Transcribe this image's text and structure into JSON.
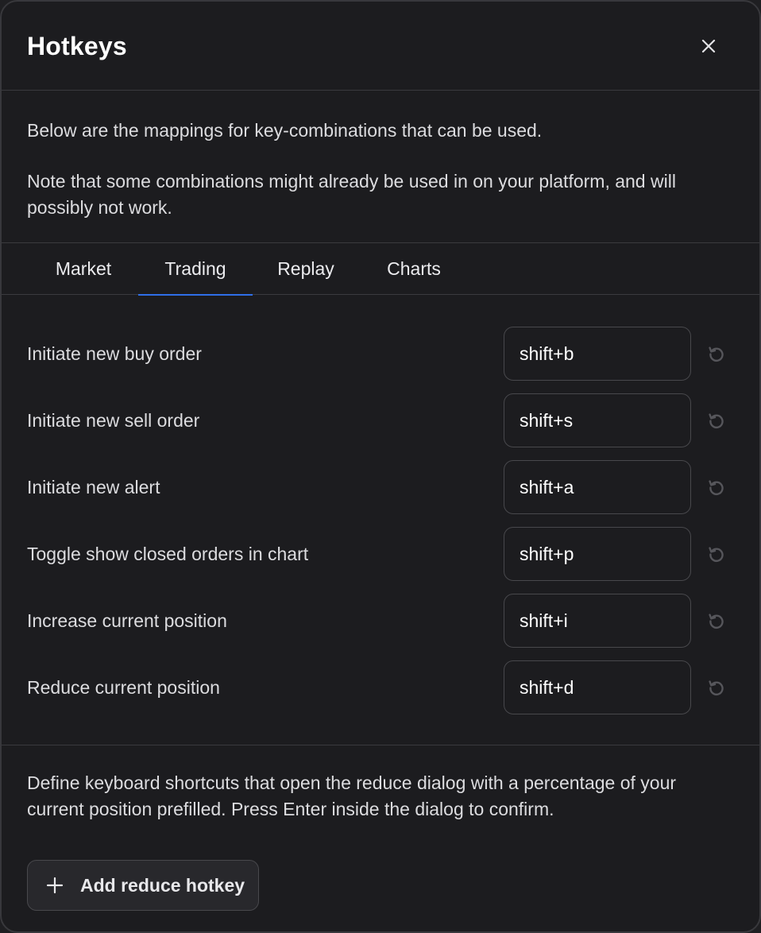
{
  "dialog": {
    "title": "Hotkeys",
    "close_label": "close"
  },
  "intro": {
    "line1": "Below are the mappings for key-combinations that can be used.",
    "line2": "Note that some combinations might already be used in on your platform, and will possibly not work."
  },
  "tabs": [
    {
      "label": "Market",
      "active": false
    },
    {
      "label": "Trading",
      "active": true
    },
    {
      "label": "Replay",
      "active": false
    },
    {
      "label": "Charts",
      "active": false
    }
  ],
  "hotkeys": [
    {
      "label": "Initiate new buy order",
      "value": "shift+b"
    },
    {
      "label": "Initiate new sell order",
      "value": "shift+s"
    },
    {
      "label": "Initiate new alert",
      "value": "shift+a"
    },
    {
      "label": "Toggle show closed orders in chart",
      "value": "shift+p"
    },
    {
      "label": "Increase current position",
      "value": "shift+i"
    },
    {
      "label": "Reduce current position",
      "value": "shift+d"
    }
  ],
  "reduce": {
    "description": "Define keyboard shortcuts that open the reduce dialog with a percentage of your current position prefilled. Press Enter inside the dialog to confirm.",
    "add_button_label": "Add reduce hotkey"
  },
  "colors": {
    "background": "#1c1c1f",
    "accent": "#2f6fe8",
    "border": "#3a3a3e"
  },
  "icons": {
    "close": "close-icon",
    "reset": "reset-icon",
    "add": "plus-icon"
  }
}
